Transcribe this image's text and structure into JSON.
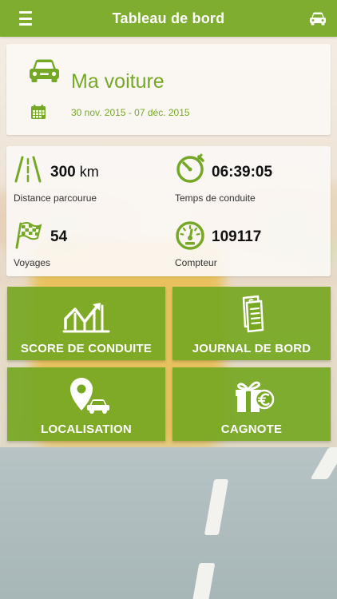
{
  "header": {
    "title": "Tableau de bord",
    "menu_icon": "hamburger-menu-icon",
    "car_icon": "car-icon"
  },
  "vehicle": {
    "name": "Ma voiture",
    "date_range": "30 nov. 2015 - 07 déc. 2015",
    "icon": "car-front-icon",
    "calendar_icon": "calendar-icon"
  },
  "stats": {
    "distance": {
      "value": "300",
      "unit": "km",
      "label": "Distance parcourue",
      "icon": "road-icon"
    },
    "drive_time": {
      "value": "06:39:05",
      "label": "Temps de conduite",
      "icon": "stopwatch-icon"
    },
    "trips": {
      "value": "54",
      "label": "Voyages",
      "icon": "checkered-flag-icon"
    },
    "odometer": {
      "value": "109117",
      "label": "Compteur",
      "icon": "speedometer-icon"
    }
  },
  "tiles": [
    {
      "label": "SCORE DE CONDUITE",
      "icon": "chart-trend-icon"
    },
    {
      "label": "JOURNAL DE BORD",
      "icon": "logbook-icon"
    },
    {
      "label": "LOCALISATION",
      "icon": "location-pin-car-icon"
    },
    {
      "label": "CAGNOTE",
      "icon": "gift-euro-icon"
    }
  ],
  "colors": {
    "brand_green": "#7fad2f",
    "tile_green": "#76a822",
    "text_green": "#76a828"
  }
}
